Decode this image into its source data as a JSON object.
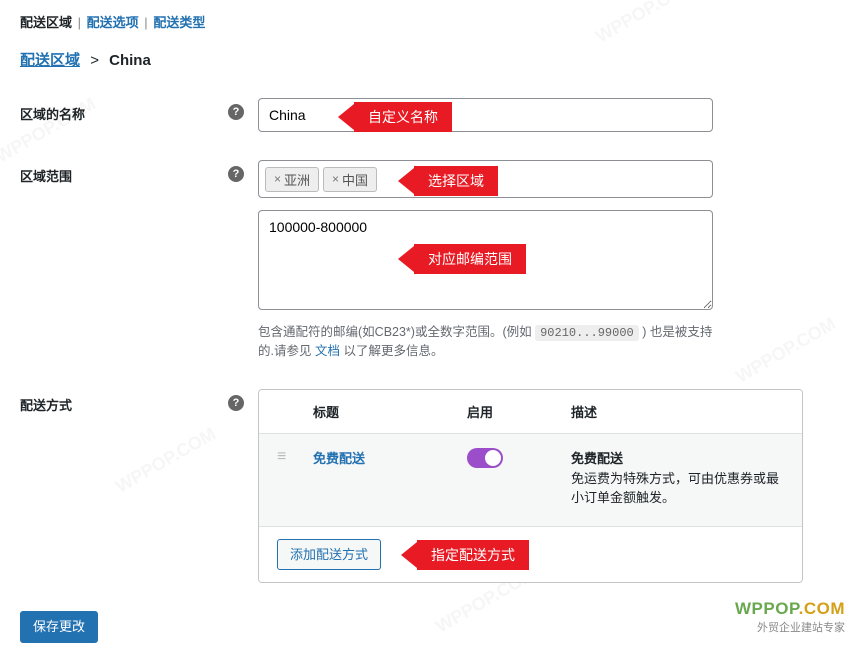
{
  "tabs": {
    "zones": "配送区域",
    "options": "配送选项",
    "classes": "配送类型"
  },
  "breadcrumb": {
    "root": "配送区域",
    "current": "China"
  },
  "labels": {
    "zone_name": "区域的名称",
    "zone_regions": "区域范围",
    "shipping_methods": "配送方式"
  },
  "zone_name": {
    "value": "China"
  },
  "zone_regions": {
    "tags": [
      "亚洲",
      "中国"
    ],
    "postcodes": "100000-800000",
    "hint_prefix": "包含通配符的邮编(如CB23*)或全数字范围。(例如 ",
    "hint_code": "90210...99000",
    "hint_mid": " ) 也是被支持的.请参见 ",
    "hint_link": "文档",
    "hint_suffix": " 以了解更多信息。"
  },
  "callouts": {
    "name": "自定义名称",
    "region": "选择区域",
    "postcode": "对应邮编范围",
    "method": "指定配送方式"
  },
  "methods_table": {
    "headers": {
      "title": "标题",
      "enabled": "启用",
      "description": "描述"
    },
    "row": {
      "title": "免费配送",
      "desc_title": "免费配送",
      "desc_text": "免运费为特殊方式，可由优惠券或最小订单金额触发。"
    },
    "add_button": "添加配送方式"
  },
  "save_button": "保存更改",
  "brand": {
    "logo_w": "WPPOP",
    "logo_c": ".COM",
    "sub": "外贸企业建站专家"
  }
}
